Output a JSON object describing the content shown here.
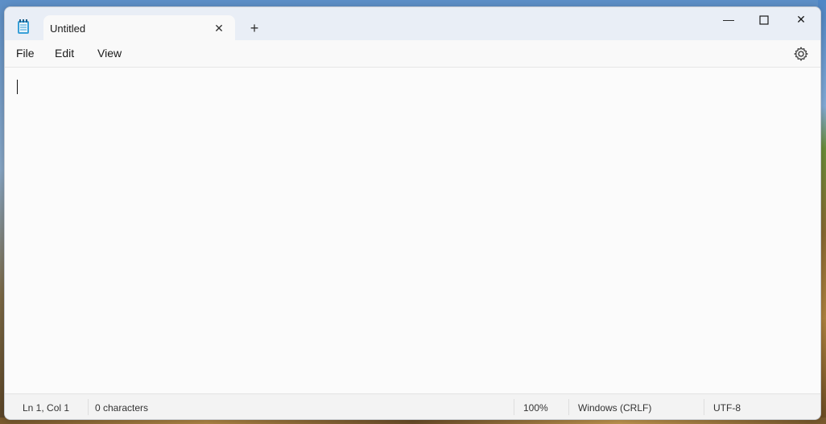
{
  "tab": {
    "title": "Untitled"
  },
  "menu": {
    "file": "File",
    "edit": "Edit",
    "view": "View"
  },
  "status": {
    "position": "Ln 1, Col 1",
    "characters": "0 characters",
    "zoom": "100%",
    "line_ending": "Windows (CRLF)",
    "encoding": "UTF-8"
  },
  "colors": {
    "titlebar": "#e9eef6",
    "editor": "#fbfbfb",
    "statusbar": "#f3f3f3"
  },
  "icons": {
    "app": "notepad-icon",
    "tab_close": "close-icon",
    "new_tab": "plus-icon",
    "minimize": "minimize-icon",
    "maximize": "maximize-icon",
    "close": "close-icon",
    "settings": "gear-icon"
  }
}
